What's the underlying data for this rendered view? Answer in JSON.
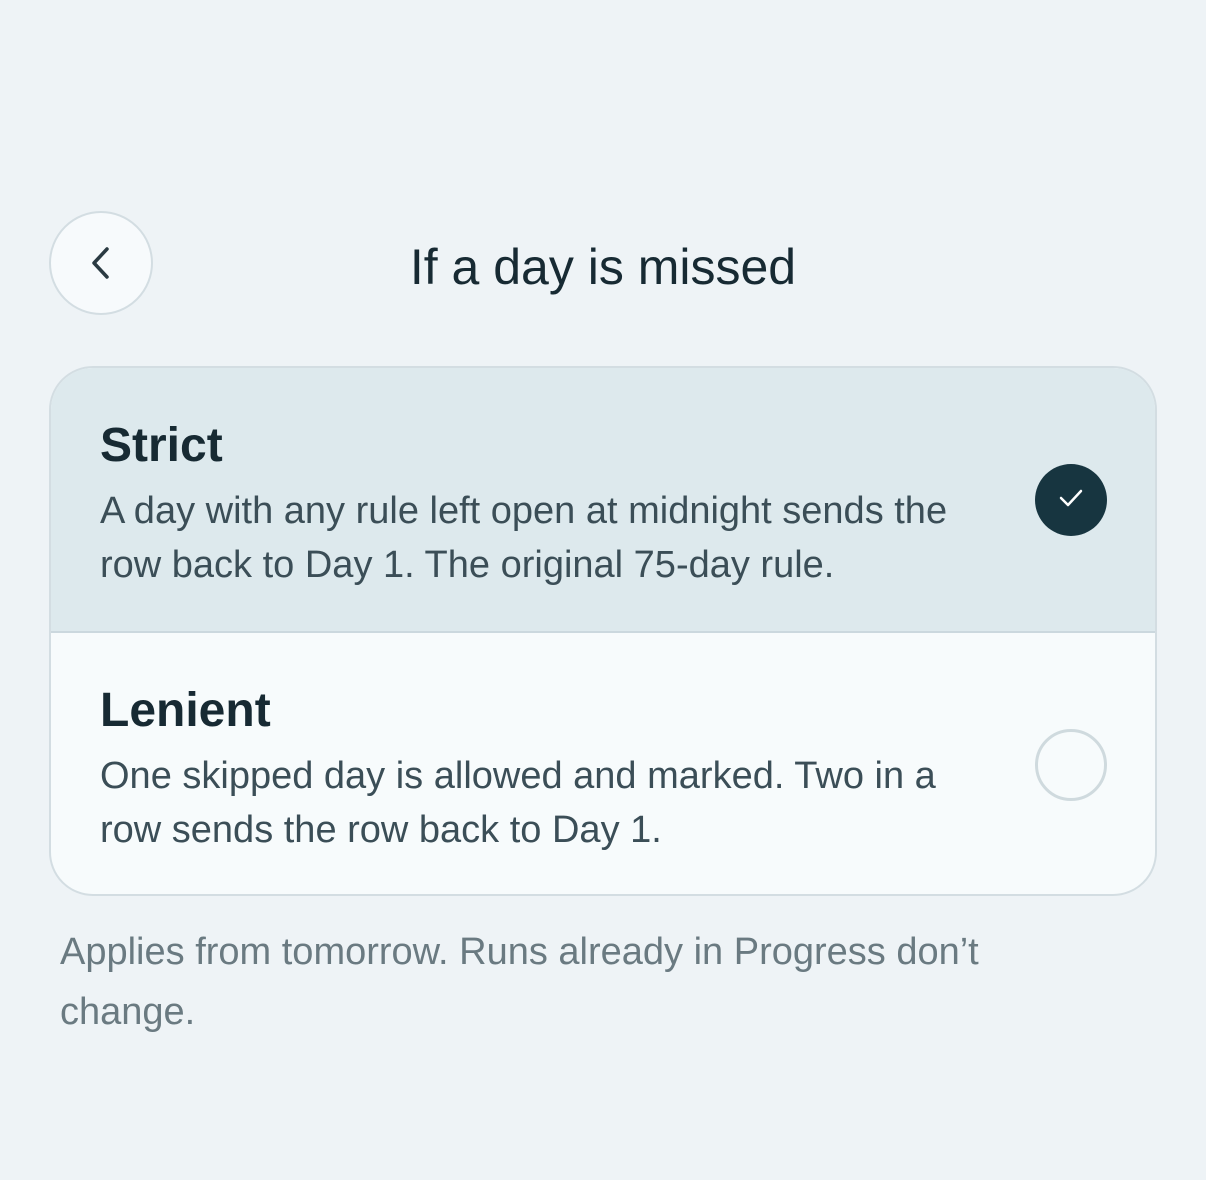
{
  "header": {
    "title": "If a day is missed",
    "back_icon": "chevron-left-icon"
  },
  "options": [
    {
      "title": "Strict",
      "description": "A day with any rule left open at midnight sends the row back to Day 1. The original 75-day rule.",
      "selected": true
    },
    {
      "title": "Lenient",
      "description": "One skipped day is allowed and marked. Two in a row sends the row back to Day 1.",
      "selected": false
    }
  ],
  "footnote": "Applies from tomorrow. Runs already in Progress don’t change.",
  "colors": {
    "background": "#eef3f6",
    "selected_row": "#dde9ed",
    "accent": "#173540",
    "text_primary": "#172a33",
    "text_secondary": "#3b4e57",
    "text_muted": "#6a7a81"
  }
}
